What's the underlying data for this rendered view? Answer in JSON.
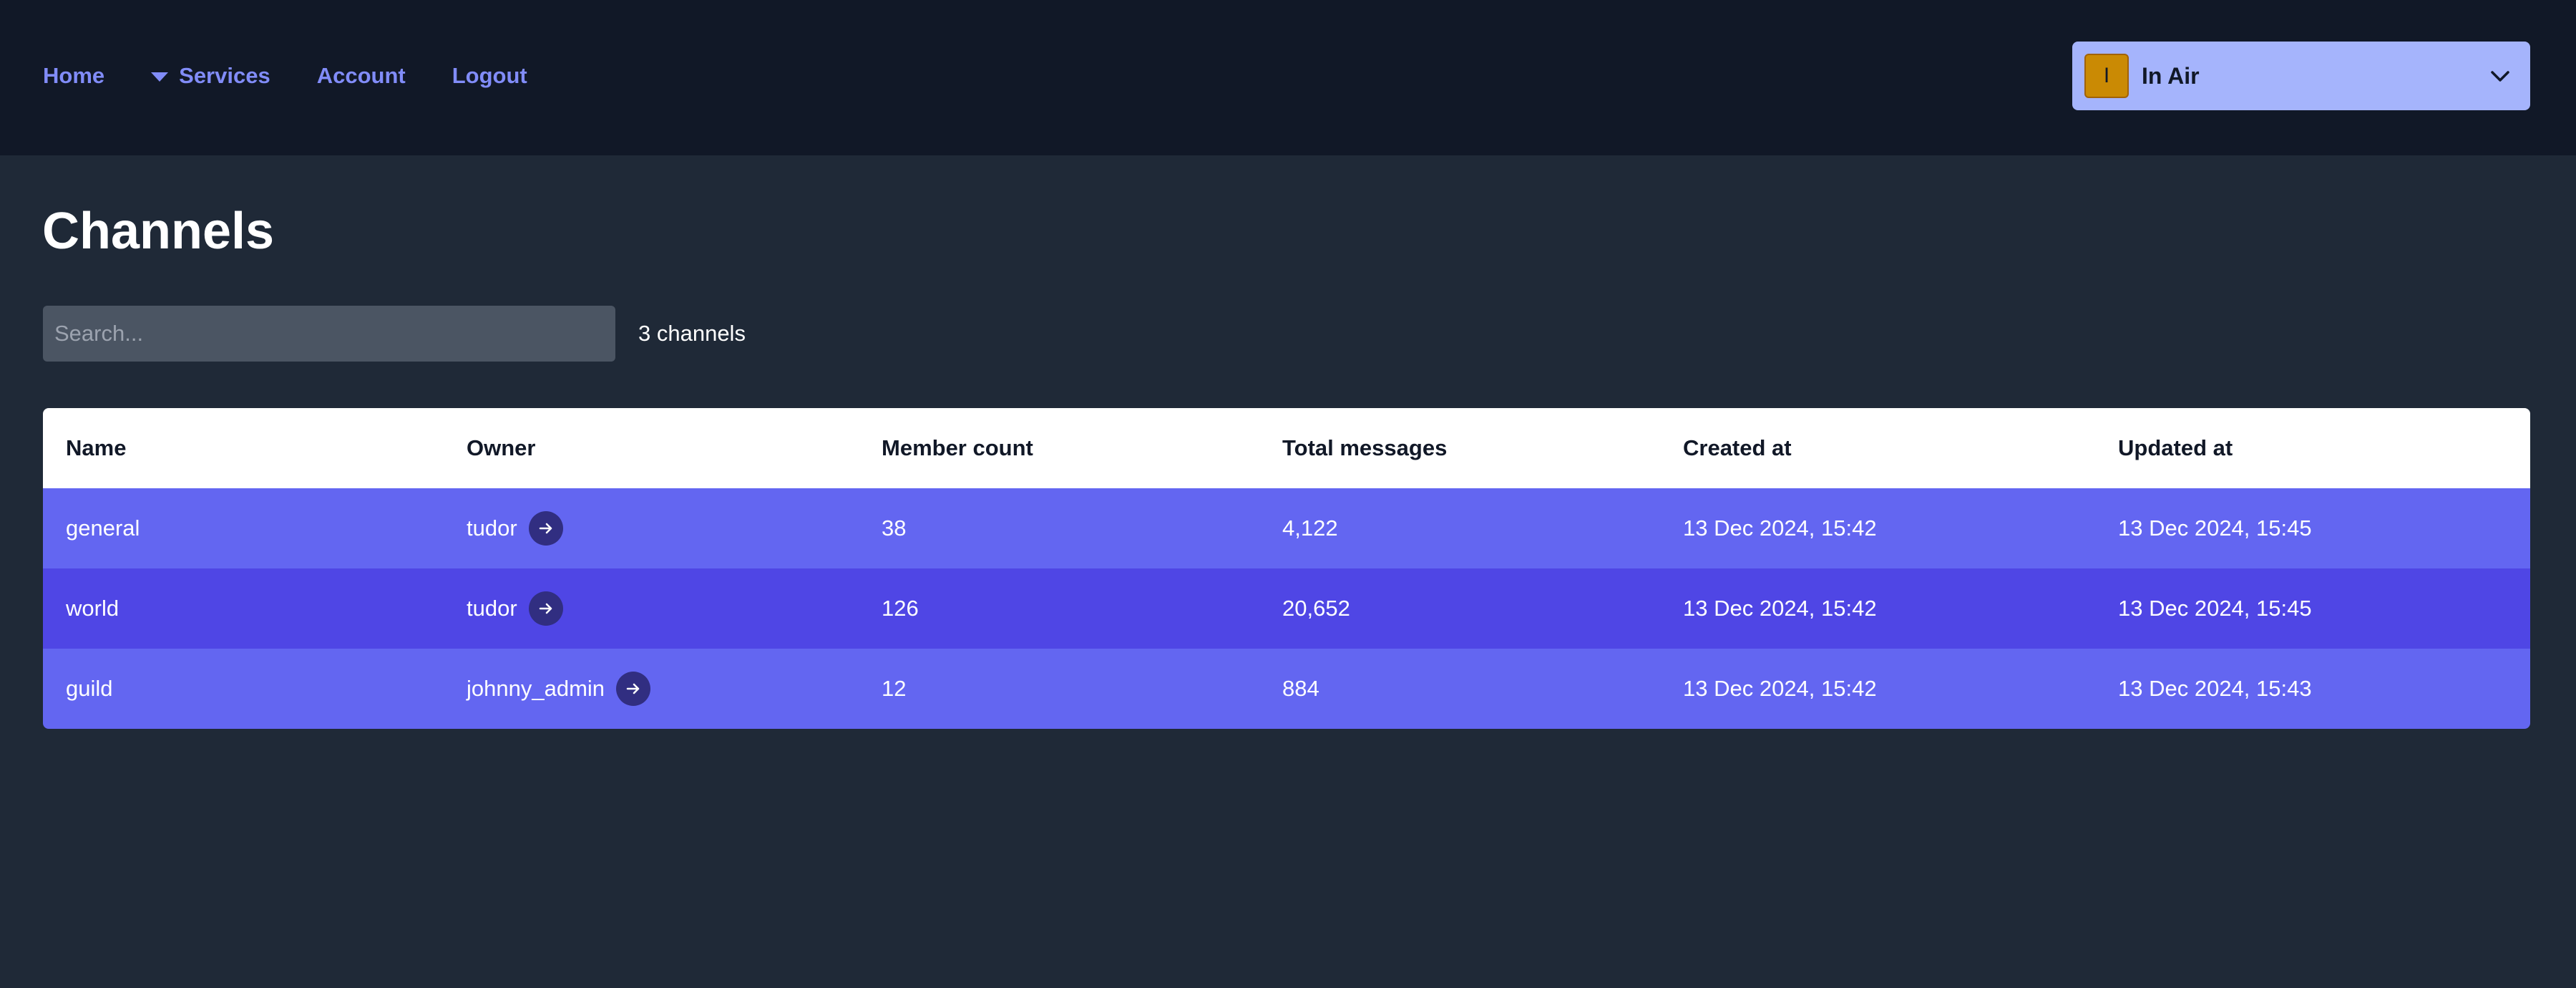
{
  "nav": {
    "home": "Home",
    "services": "Services",
    "account": "Account",
    "logout": "Logout"
  },
  "workspace": {
    "initial": "I",
    "name": "In Air",
    "icon": "chevron-down-icon"
  },
  "page": {
    "title": "Channels",
    "search_placeholder": "Search...",
    "count": "3 channels"
  },
  "table": {
    "columns": [
      "Name",
      "Owner",
      "Member count",
      "Total messages",
      "Created at",
      "Updated at"
    ],
    "rows": [
      {
        "name": "general",
        "owner": "tudor",
        "members": "38",
        "messages": "4,122",
        "created": "13 Dec 2024, 15:42",
        "updated": "13 Dec 2024, 15:45"
      },
      {
        "name": "world",
        "owner": "tudor",
        "members": "126",
        "messages": "20,652",
        "created": "13 Dec 2024, 15:42",
        "updated": "13 Dec 2024, 15:45"
      },
      {
        "name": "guild",
        "owner": "johnny_admin",
        "members": "12",
        "messages": "884",
        "created": "13 Dec 2024, 15:42",
        "updated": "13 Dec 2024, 15:43"
      }
    ]
  },
  "colors": {
    "topbar": "#111827",
    "background": "#1f2937",
    "nav_link": "#818cf8",
    "row_light": "#6366f1",
    "row_dark": "#4f46e5",
    "workspace_bg": "#a5b4fc",
    "avatar": "#ca8a04"
  }
}
